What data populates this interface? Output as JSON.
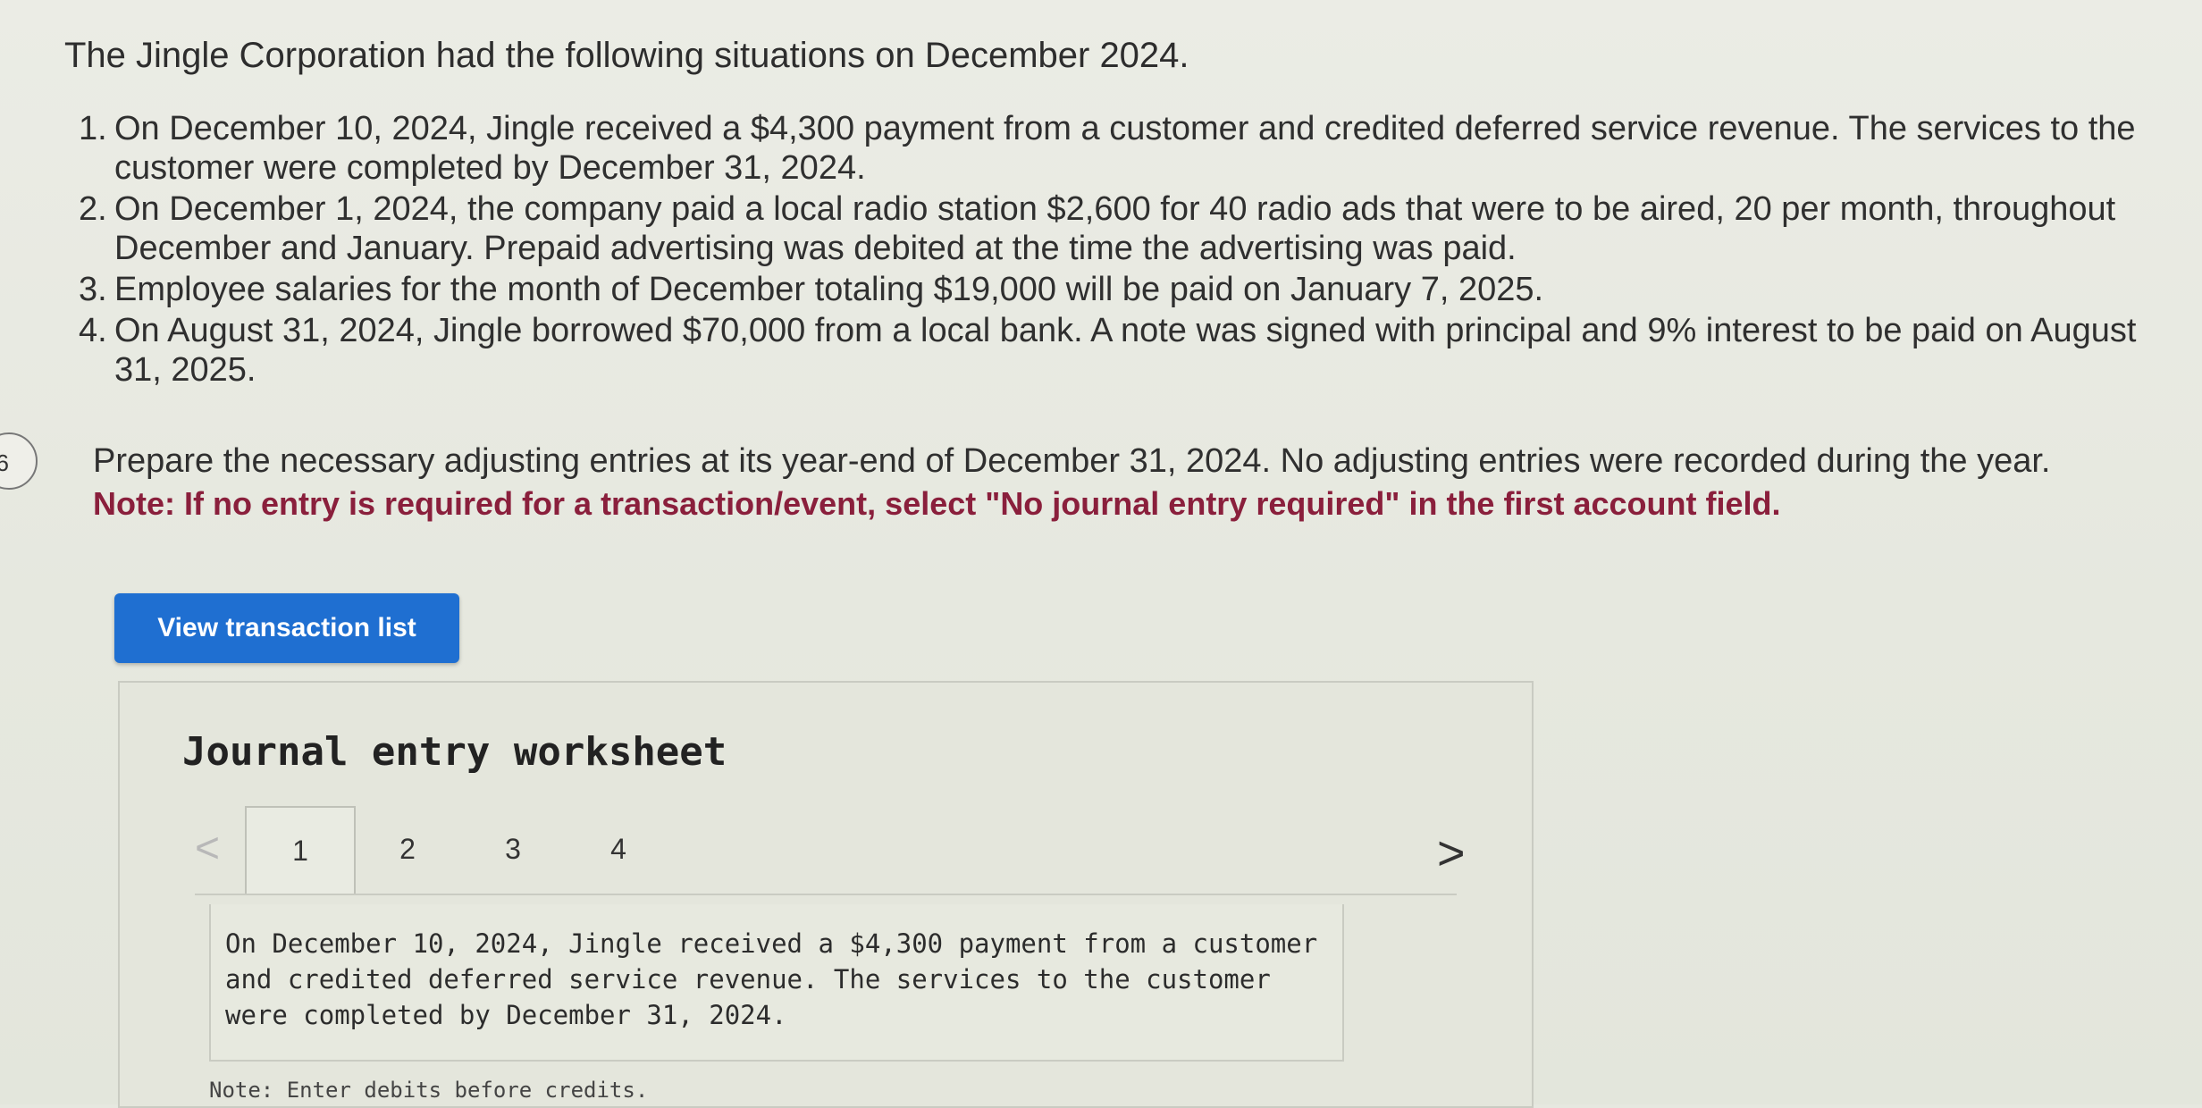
{
  "intro": "The Jingle Corporation had the following situations on December 2024.",
  "situations": [
    {
      "num": "1.",
      "text": "On December 10, 2024, Jingle received a $4,300 payment from a customer and credited deferred service revenue. The services to the customer were completed by December 31, 2024."
    },
    {
      "num": "2.",
      "text": "On December 1, 2024, the company paid a local radio station $2,600 for 40 radio ads that were to be aired, 20 per month, throughout December and January. Prepaid advertising was debited at the time the advertising was paid."
    },
    {
      "num": "3.",
      "text": "Employee salaries for the month of December totaling $19,000 will be paid on January 7, 2025."
    },
    {
      "num": "4.",
      "text": "On August 31, 2024, Jingle borrowed $70,000 from a local bank. A note was signed with principal and 9% interest to be paid on August 31, 2025."
    }
  ],
  "question_number": "6",
  "instructions": {
    "text": "Prepare the necessary adjusting entries at its year-end of December 31, 2024. No adjusting entries were recorded during the year.",
    "note": "Note: If no entry is required for a transaction/event, select \"No journal entry required\" in the first account field."
  },
  "view_button_label": "View transaction list",
  "worksheet": {
    "title": "Journal entry worksheet",
    "prev_icon": "<",
    "next_icon": ">",
    "tabs": [
      {
        "label": "1",
        "active": true
      },
      {
        "label": "2",
        "active": false
      },
      {
        "label": "3",
        "active": false
      },
      {
        "label": "4",
        "active": false
      }
    ],
    "scenario_text": "On December 10, 2024, Jingle received a $4,300 payment from a customer and credited deferred service revenue. The services to the customer were completed by December 31, 2024.",
    "enter_note": "Note: Enter debits before credits."
  },
  "colors": {
    "button_bg": "#1f6fd1",
    "note_text": "#8a1f3c",
    "page_bg": "#e6e8e0"
  }
}
